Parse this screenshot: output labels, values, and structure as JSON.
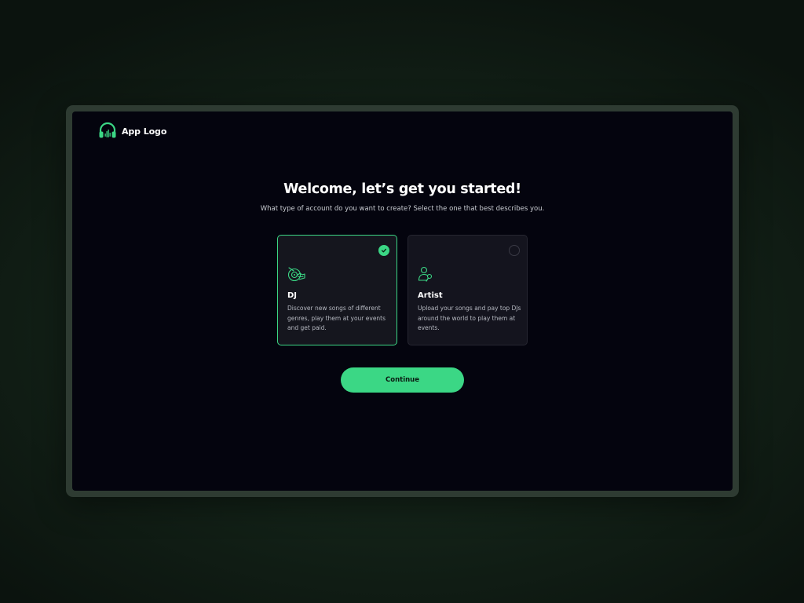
{
  "brand": {
    "logo_text": "App Logo",
    "logo_icon": "headphones-icon",
    "accent_color": "#3BD785"
  },
  "onboarding": {
    "title": "Welcome, let’s get you started!",
    "subtitle": "What type of account do you want to create? Select the one that best describes you.",
    "options": [
      {
        "title": "DJ",
        "description": "Discover new songs of different genres, play them at your events and get paid.",
        "icon": "turntable-icon",
        "selected": true
      },
      {
        "title": "Artist",
        "description": "Upload your songs and pay top DJs around the world to play them at events.",
        "icon": "artist-icon",
        "selected": false
      }
    ],
    "continue_label": "Continue"
  }
}
